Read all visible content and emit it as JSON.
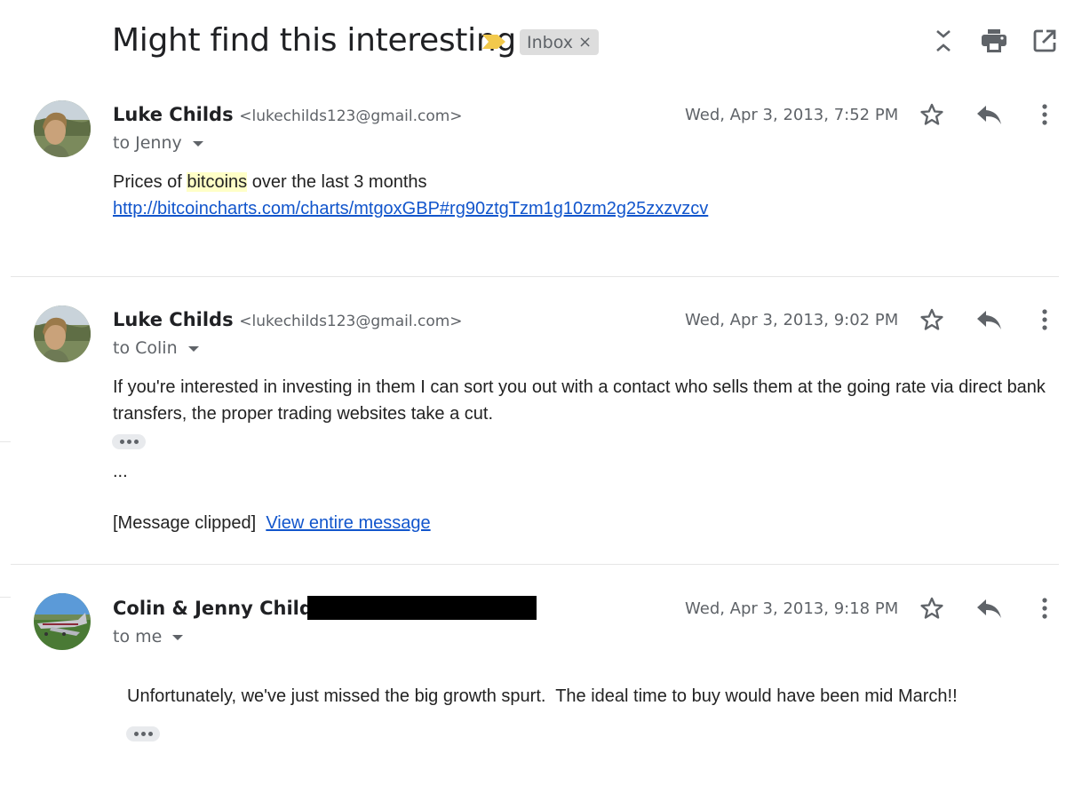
{
  "thread": {
    "subject": "Might find this interesting",
    "label": "Inbox",
    "label_remove_glyph": "×",
    "importance_color": "#f2c94c",
    "toolbar_icons": [
      "collapse-all-icon",
      "print-icon",
      "open-in-new-window-icon"
    ]
  },
  "messages": [
    {
      "sender_name": "Luke Childs",
      "sender_email": "<lukechilds123@gmail.com>",
      "recipient": "to Jenny",
      "timestamp": "Wed, Apr 3, 2013, 7:52 PM",
      "avatar": "person-photo",
      "body_before_highlight": "Prices of ",
      "body_highlight": "bitcoins",
      "body_after_highlight": " over the last 3 months",
      "link": "http://bitcoincharts.com/charts/mtgoxGBP#rg90ztgTzm1g10zm2g25zxzvzcv"
    },
    {
      "sender_name": "Luke Childs",
      "sender_email": "<lukechilds123@gmail.com>",
      "recipient": "to Colin",
      "timestamp": "Wed, Apr 3, 2013, 9:02 PM",
      "avatar": "person-photo",
      "body": "If you're interested in investing in them I can sort you out with a contact who sells them at the going rate via direct bank transfers, the proper trading websites take a cut.",
      "ellipsis": "...",
      "clipped_text": "[Message clipped]",
      "view_entire_label": "View entire message"
    },
    {
      "sender_name": "Colin & Jenny Childs",
      "sender_email_redacted": true,
      "recipient": "to me",
      "timestamp": "Wed, Apr 3, 2013, 9:18 PM",
      "avatar": "airplane-photo",
      "body": "Unfortunately, we've just missed the big growth spurt.  The ideal time to buy would have been mid March!!"
    }
  ]
}
